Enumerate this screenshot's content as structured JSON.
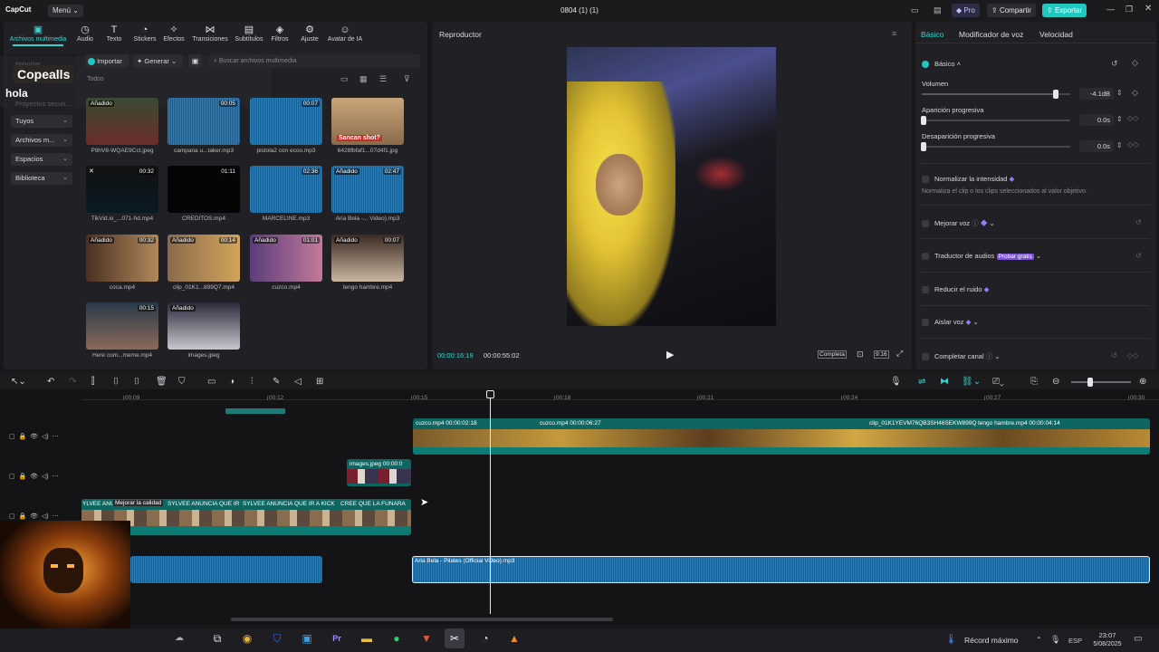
{
  "app": {
    "logo": "CapCut",
    "menu": "Menú",
    "doc_title": "0804 (1) (1)",
    "pro": "Pro",
    "share": "Compartir",
    "export": "Exportar"
  },
  "toolbar": [
    {
      "label": "Archivos multimedia",
      "icon": "media-icon"
    },
    {
      "label": "Audio",
      "icon": "audio-icon"
    },
    {
      "label": "Texto",
      "icon": "text-icon"
    },
    {
      "label": "Stickers",
      "icon": "sticker-icon"
    },
    {
      "label": "Efectos",
      "icon": "effects-icon"
    },
    {
      "label": "Transiciones",
      "icon": "transition-icon"
    },
    {
      "label": "Subtítulos",
      "icon": "subtitles-icon"
    },
    {
      "label": "Filtros",
      "icon": "filter-icon"
    },
    {
      "label": "Ajuste",
      "icon": "adjust-icon"
    },
    {
      "label": "Avatar de IA",
      "icon": "avatar-icon"
    }
  ],
  "overlay": {
    "name": "Copealls",
    "text": "hola"
  },
  "sidebar": {
    "items": [
      "Importar",
      "Proyectos secun...",
      "Tuyos",
      "Archivos m...",
      "Espacios",
      "Biblioteca"
    ]
  },
  "media_toolbar": {
    "import": "Importar",
    "generate": "Generar",
    "search_placeholder": "Buscar archivos multimedia",
    "filter_all": "Todos"
  },
  "media": [
    {
      "name": "P9hV8-WQAE9Cct.jpeg",
      "badge": "Añadido",
      "dur": ""
    },
    {
      "name": "campana u...taker.mp3",
      "badge": "",
      "dur": "00:05"
    },
    {
      "name": "pistola2 con ecoo.mp3",
      "badge": "",
      "dur": "00:07"
    },
    {
      "name": "6428fbfaf1...07d4f1.jpg",
      "badge": "",
      "dur": "",
      "caption": "Sancan shot?"
    },
    {
      "name": "TikVid.io_...071-hd.mp4",
      "badge": "",
      "dur": "00:32"
    },
    {
      "name": "CREDITOS.mp4",
      "badge": "",
      "dur": "01:11"
    },
    {
      "name": "MARCELINE.mp3",
      "badge": "",
      "dur": "02:36"
    },
    {
      "name": "Aria Bela -... Video).mp3",
      "badge": "Añadido",
      "dur": "02:47"
    },
    {
      "name": "coca.mp4",
      "badge": "Añadido",
      "dur": "00:32"
    },
    {
      "name": "clip_01K1...899Q7.mp4",
      "badge": "Añadido",
      "dur": "00:14"
    },
    {
      "name": "cuzco.mp4",
      "badge": "Añadido",
      "dur": "01:01"
    },
    {
      "name": "tengo hambre.mp4",
      "badge": "Añadido",
      "dur": "00:07"
    },
    {
      "name": "Here com...meme.mp4",
      "badge": "",
      "dur": "00:15"
    },
    {
      "name": "images.jpeg",
      "badge": "Añadido",
      "dur": ""
    }
  ],
  "player": {
    "title": "Reproductor",
    "current": "00:00:16:19",
    "total": "00:00:55:02",
    "full": "Completa",
    "ratio": "9:16"
  },
  "props": {
    "tabs": [
      "Básico",
      "Modificador de voz",
      "Velocidad"
    ],
    "section": "Básico",
    "volume_label": "Volumen",
    "volume_value": "-4.1dB",
    "volume_level": 0.9,
    "fade_in_label": "Aparición progresiva",
    "fade_in_value": "0.0s",
    "fade_out_label": "Desaparición progresiva",
    "fade_out_value": "0.0s",
    "normalize": "Normalizar la intensidad",
    "normalize_desc": "Normaliza el clip o los clips seleccionados al valor objetivo.",
    "enhance": "Mejorar voz",
    "translator": "Traductor de audios",
    "try_free": "Probar gratis",
    "noise": "Reducir el ruido",
    "isolate": "Aislar voz",
    "complete": "Completar canal"
  },
  "timeline": {
    "ruler": [
      "00:09",
      "00:12",
      "00:15",
      "00:18",
      "00:21",
      "00:24",
      "00:27",
      "00:30"
    ],
    "clips": {
      "cuzco1": "cuzco.mp4  00:00:02:18",
      "cuzco2": "cuzco.mp4  00:00:06:27",
      "clip3": "clip_01K1YEVM76QB3SH46SEKW899Q",
      "tengo": "tengo hambre.mp4  00:00:04:14",
      "images": "images.jpeg  00:00:0",
      "t1": "YLVEE ANU",
      "t2": "Mejorar la calidad",
      "t3": "SYLVEE ANUNCIA QUE IR",
      "t4": "SYLVEE ANUNCIA QUE IR A KICK",
      "t5": "CREE QUE LA FUNARA",
      "audio": "Aria Bela - Pilates (Official Video).mp3"
    }
  },
  "taskbar": {
    "record": "Récord máximo",
    "lang": "ESP",
    "time": "23:07",
    "date": "5/08/2025"
  }
}
